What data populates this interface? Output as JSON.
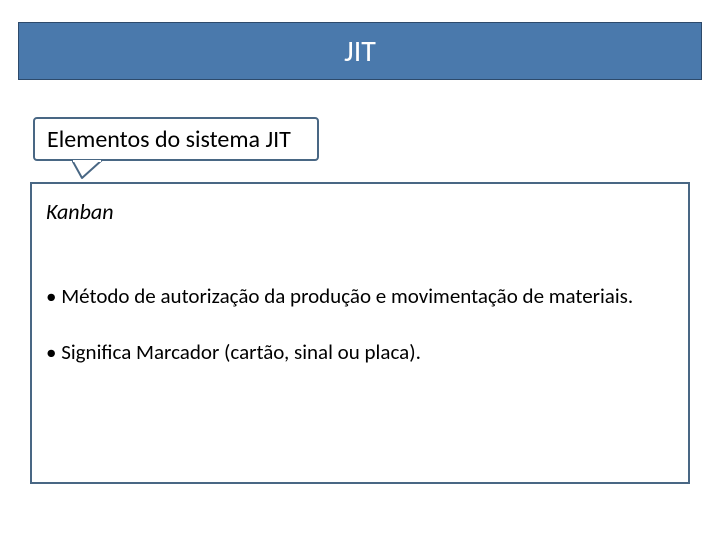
{
  "title": "JIT",
  "subtitle": "Elementos  do sistema JIT",
  "section_heading": "Kanban",
  "bullets": [
    "• Método de autorização da produção e movimentação de materiais.",
    "• Significa Marcador (cartão, sinal ou placa)."
  ],
  "colors": {
    "bar_bg": "#4a79ac",
    "border": "#496784"
  }
}
